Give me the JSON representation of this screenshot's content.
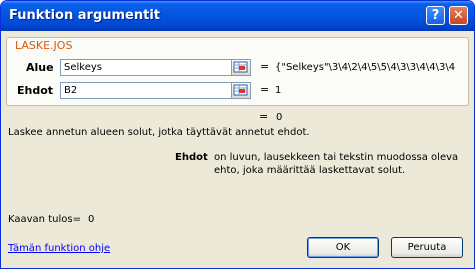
{
  "window": {
    "title": "Funktion argumentit",
    "help_glyph": "?",
    "close_glyph": "✕"
  },
  "function": {
    "name": "LASKE.JOS",
    "args": [
      {
        "label": "Alue",
        "value": "Selkeys",
        "result": "{\"Selkeys\"\\3\\4\\2\\4\\5\\5\\4\\3\\3\\4\\4\\3\\4"
      },
      {
        "label": "Ehdot",
        "value": "B2",
        "result": "1"
      }
    ],
    "equals": "=",
    "result_total": "0",
    "description": "Laskee annetun alueen solut, jotka täyttävät annetut ehdot.",
    "param_name": "Ehdot",
    "param_desc_line1": "on luvun, lausekkeen tai tekstin muodossa oleva",
    "param_desc_line2": "ehto, joka määrittää laskettavat solut."
  },
  "formula_result": {
    "label": "Kaavan tulos=",
    "value": "0"
  },
  "help_link": "Tämän funktion ohje",
  "buttons": {
    "ok": "OK",
    "cancel": "Peruuta"
  }
}
